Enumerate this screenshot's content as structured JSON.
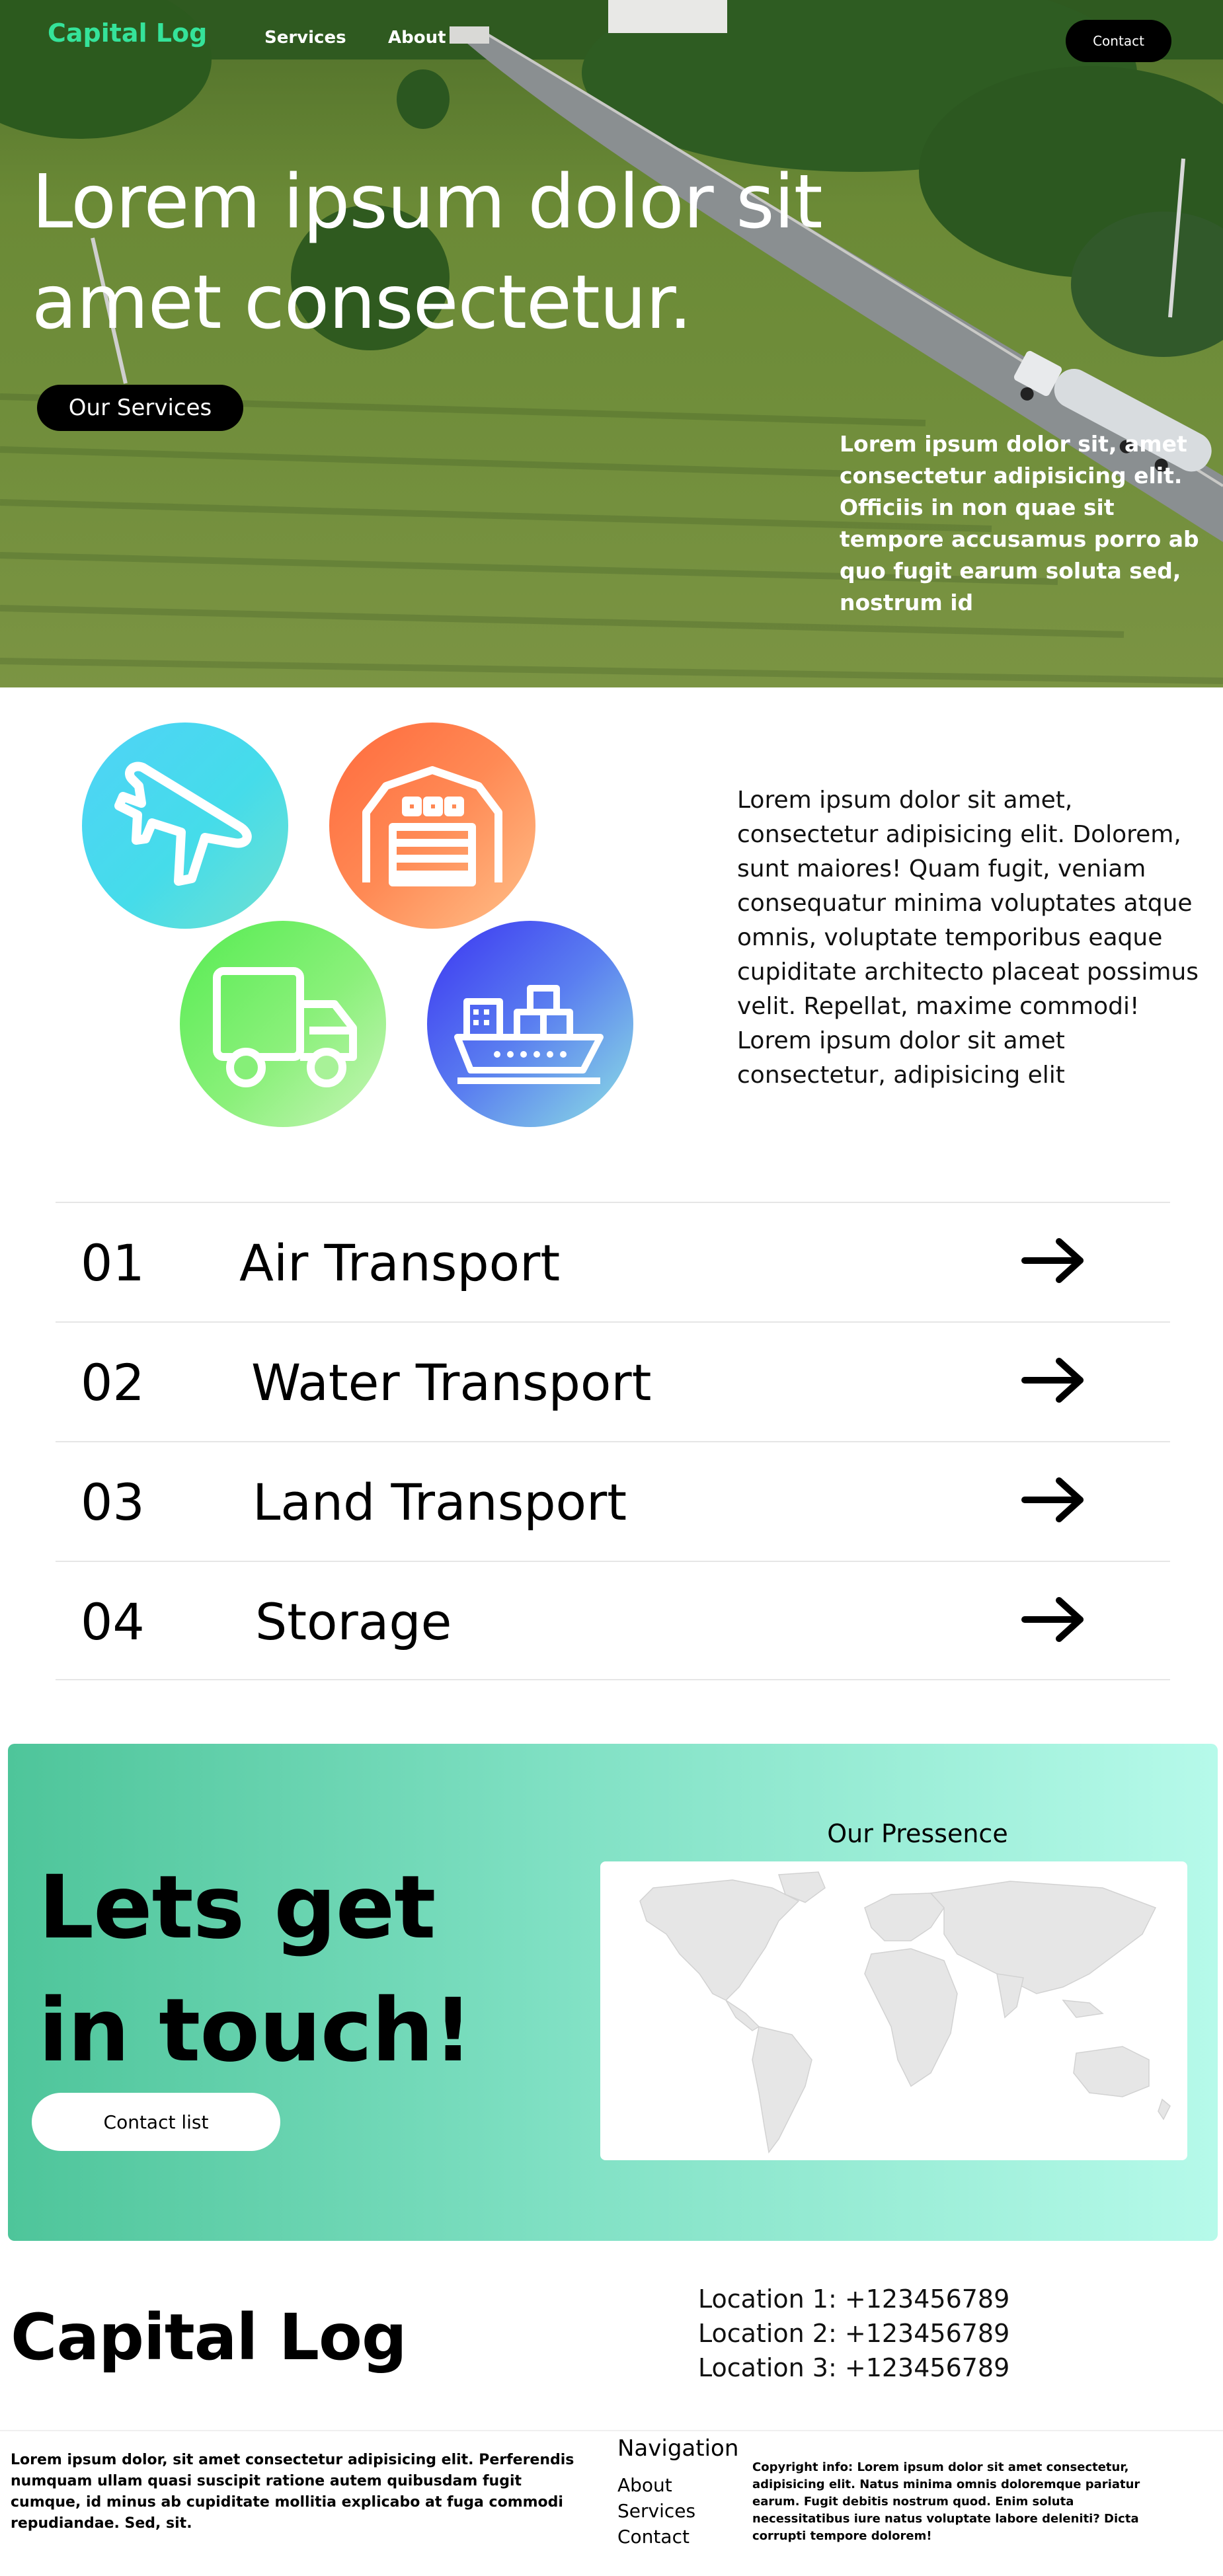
{
  "header": {
    "logo": "Capital Log",
    "nav": [
      "Services",
      "About"
    ],
    "contact_label": "Contact"
  },
  "hero": {
    "title": "Lorem ipsum dolor sit amet consectetur.",
    "services_button": "Our Services",
    "side_text": "Lorem ipsum dolor sit, amet consectetur adipisicing elit. Officiis in non quae sit tempore accusamus porro ab quo fugit earum soluta sed, nostrum id"
  },
  "icons": [
    "airplane-icon",
    "warehouse-icon",
    "truck-icon",
    "cargo-ship-icon"
  ],
  "intro_text": "Lorem ipsum dolor sit amet, consectetur adipisicing elit. Dolorem, sunt maiores! Quam fugit, veniam consequatur minima voluptates atque omnis, voluptate temporibus eaque cupiditate architecto placeat possimus velit. Repellat, maxime commodi! Lorem ipsum dolor sit amet consectetur, adipisicing elit",
  "services": [
    {
      "num": "01",
      "name": "Air Transport"
    },
    {
      "num": "02",
      "name": "Water Transport"
    },
    {
      "num": "03",
      "name": "Land Transport"
    },
    {
      "num": "04",
      "name": "Storage"
    }
  ],
  "contact_panel": {
    "title": "Lets get in touch!",
    "button": "Contact list",
    "presence_title": "Our Pressence"
  },
  "footer": {
    "logo": "Capital Log",
    "locations": [
      "Location 1: +123456789",
      "Location 2: +123456789",
      "Location 3: +123456789"
    ],
    "about": "Lorem ipsum dolor, sit amet consectetur adipisicing elit. Perferendis numquam ullam quasi suscipit ratione autem quibusdam fugit cumque, id minus ab cupiditate mollitia explicabo at fuga commodi repudiandae. Sed, sit.",
    "nav_title": "Navigation",
    "nav_items": [
      "About",
      "Services",
      "Contact"
    ],
    "copyright": "Copyright info: Lorem ipsum dolor sit amet consectetur, adipisicing elit. Natus minima omnis doloremque pariatur earum. Fugit debitis nostrum quod. Enim soluta necessitatibus iure natus voluptate labore deleniti? Dicta corrupti tempore dolorem!"
  },
  "colors": {
    "brand_green": "#35e39a",
    "button_dark": "#000000",
    "panel_gradient_start": "#4ec59a",
    "panel_gradient_end": "#b6faea"
  }
}
